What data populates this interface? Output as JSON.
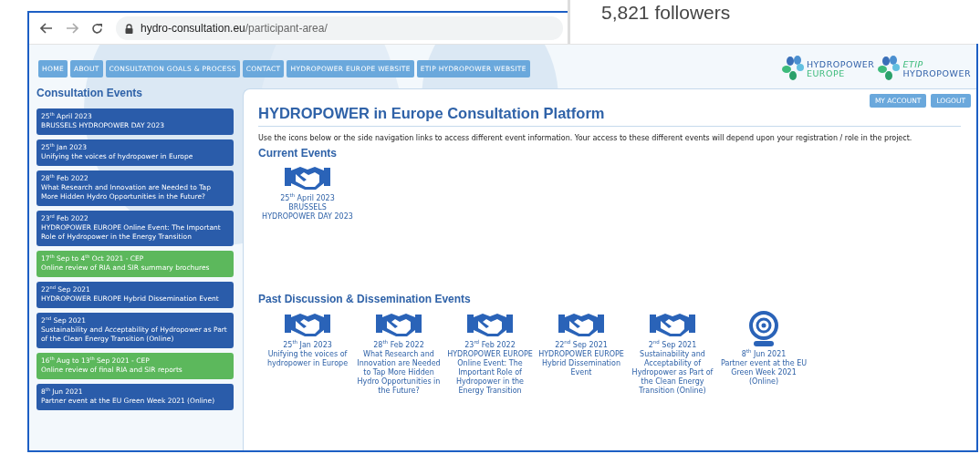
{
  "social_card": {
    "followers": "5,821 followers"
  },
  "browser": {
    "url_host": "hydro-consultation.eu",
    "url_path": "/participant-area/"
  },
  "nav": [
    {
      "label": "HOME"
    },
    {
      "label": "ABOUT"
    },
    {
      "label": "CONSULTATION GOALS & PROCESS"
    },
    {
      "label": "CONTACT"
    },
    {
      "label": "HYDROPOWER EUROPE WEBSITE"
    },
    {
      "label": "ETIP HYDROPOWER WEBSITE"
    }
  ],
  "logos": [
    {
      "line1": "HYDROPOWER",
      "line2": "EUROPE",
      "kind": "hydropower-europe"
    },
    {
      "line1": "ETIP",
      "line2": "HYDROPOWER",
      "kind": "etip"
    }
  ],
  "sidebar": {
    "title": "Consultation Events",
    "items": [
      {
        "date": "25$^{th}$ April 2023",
        "title": "BRUSSELS HYDROPOWER DAY 2023",
        "color": "#2a5caa"
      },
      {
        "date": "25$^{th}$ Jan 2023",
        "title": "Unifying the voices of hydropower in Europe",
        "color": "#2a5caa"
      },
      {
        "date": "28$^{th}$ Feb 2022",
        "title": "What Research and Innovation are Needed to Tap More Hidden Hydro Opportunities in the Future?",
        "color": "#2a5caa"
      },
      {
        "date": "23$^{rd}$ Feb 2022",
        "title": "HYDROPOWER EUROPE Online Event: The Important Role of Hydropower in the Energy Transition",
        "color": "#2a5caa"
      },
      {
        "date": "17$^{th}$ Sep to 4$^{th}$ Oct 2021 - CEP",
        "title": "Online review of RIA and SIR summary brochures",
        "color": "#5cb85c"
      },
      {
        "date": "22$^{nd}$ Sep 2021",
        "title": "HYDROPOWER EUROPE Hybrid Dissemination Event",
        "color": "#2a5caa"
      },
      {
        "date": "2$^{nd}$ Sep 2021",
        "title": "Sustainability and Acceptability of Hydropower as Part of the Clean Energy Transition (Online)",
        "color": "#2a5caa"
      },
      {
        "date": "16$^{th}$ Aug to 13$^{th}$ Sep 2021 - CEP",
        "title": "Online review of final RIA and SIR reports",
        "color": "#5cb85c"
      },
      {
        "date": "8$^{th}$ Jun 2021",
        "title": "Partner event at the EU Green Week 2021 (Online)",
        "color": "#2a5caa"
      }
    ]
  },
  "account_buttons": [
    {
      "label": "MY ACCOUNT"
    },
    {
      "label": "LOGOUT"
    }
  ],
  "main": {
    "title": "HYDROPOWER in Europe Consultation Platform",
    "intro": "Use the icons below or the side navigation links to access different event information. Your access to these different events will depend upon your registration / role in the project.",
    "current_heading": "Current Events",
    "current_events": [
      {
        "kind": "handshake",
        "lines": [
          "25$^{th}$ April 2023",
          "BRUSSELS",
          "HYDROPOWER DAY 2023"
        ]
      }
    ],
    "past_heading": "Past Discussion & Dissemination Events",
    "past_events": [
      {
        "kind": "handshake",
        "lines": [
          "25$^{th}$ Jan 2023",
          "Unifying the voices of hydropower in Europe"
        ]
      },
      {
        "kind": "handshake",
        "lines": [
          "28$^{th}$ Feb 2022",
          "What Research and Innovation are Needed to Tap More Hidden Hydro Opportunities in the Future?"
        ]
      },
      {
        "kind": "handshake",
        "lines": [
          "23$^{rd}$ Feb 2022",
          "HYDROPOWER EUROPE Online Event: The Important Role of Hydropower in the Energy Transition"
        ]
      },
      {
        "kind": "handshake",
        "lines": [
          "22$^{nd}$ Sep 2021",
          "HYDROPOWER EUROPE Hybrid Dissemination Event"
        ]
      },
      {
        "kind": "handshake",
        "lines": [
          "2$^{nd}$ Sep 2021",
          "Sustainability and Acceptability of Hydropower as Part of the Clean Energy Transition (Online)"
        ]
      },
      {
        "kind": "webcam",
        "lines": [
          "8$^{th}$ Jun 2021",
          "Partner event at the EU Green Week 2021 (Online)"
        ]
      }
    ]
  }
}
